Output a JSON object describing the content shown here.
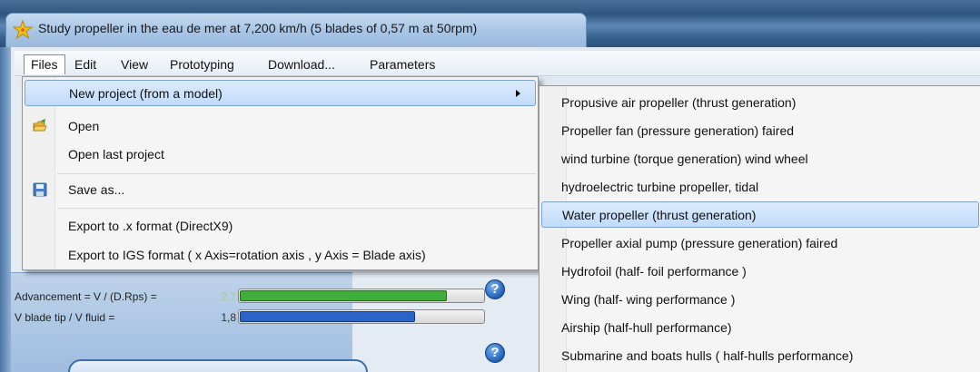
{
  "window": {
    "title": "Study propeller in the eau de mer at 7,200 km/h (5 blades of 0,57 m at 50rpm)"
  },
  "menubar": {
    "items": [
      "Files",
      "Edit",
      "View",
      "Prototyping",
      "Download...",
      "Parameters"
    ],
    "active": "Files"
  },
  "files_menu": {
    "items": [
      {
        "label": "New project (from a model)",
        "icon": "",
        "has_submenu": true,
        "highlighted": true
      },
      {
        "label": "Open",
        "icon": "open-folder-icon"
      },
      {
        "label": "Open last project",
        "icon": ""
      },
      {
        "label": "Save as...",
        "icon": "floppy-disk-icon"
      },
      {
        "label": "Export to  .x format (DirectX9)",
        "icon": ""
      },
      {
        "label": "Export to  IGS format ( x Axis=rotation axis ,  y Axis = Blade axis)",
        "icon": ""
      }
    ]
  },
  "new_project_submenu": {
    "items": [
      "Propusive air propeller (thrust generation)",
      "Propeller fan (pressure generation) faired",
      "wind turbine (torque generation) wind wheel",
      "hydroelectric turbine propeller, tidal",
      "Water propeller (thrust generation)",
      "Propeller axial pump (pressure generation) faired",
      "Hydrofoil (half- foil performance )",
      "Wing (half- wing performance )",
      "Airship (half-hull performance)",
      "Submarine and boats  hulls ( half-hulls performance)"
    ],
    "highlighted_index": 4
  },
  "gauges": [
    {
      "label": "Advancement = V / (D.Rps) =",
      "value": "2,7",
      "fill_fraction": 0.85,
      "color": "#3fae3a"
    },
    {
      "label": "V blade tip / V fluid =",
      "value": "1,8",
      "fill_fraction": 0.72,
      "color": "#2b63c9"
    }
  ],
  "colors": {
    "highlight": "#c1dbfc",
    "highlight_border": "#7da2ce",
    "titlebar": "#2f5580"
  }
}
